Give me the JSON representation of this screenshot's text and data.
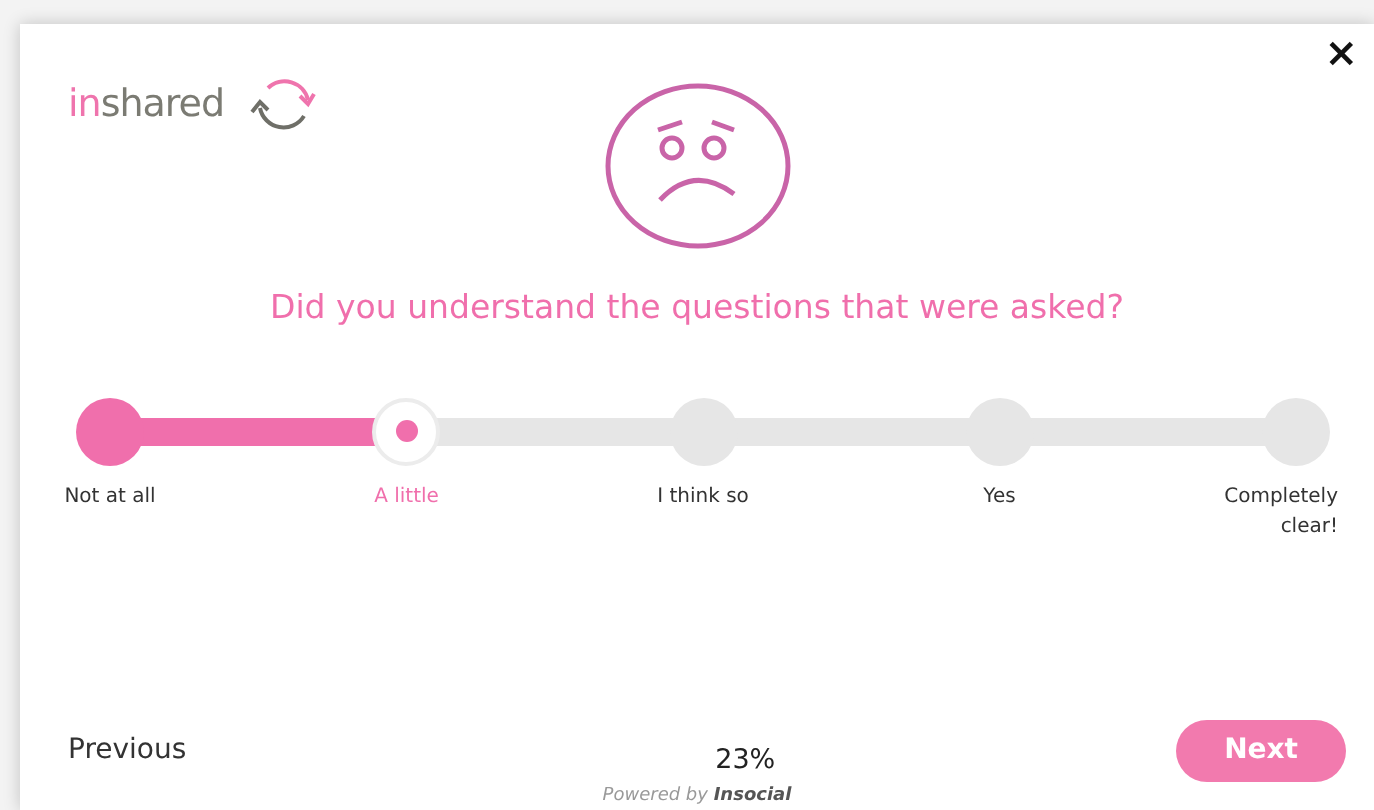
{
  "logo": {
    "prefix": "in",
    "suffix": "shared"
  },
  "close": "×",
  "question": "Did you understand the questions that were asked?",
  "options": [
    {
      "label": "Not at all",
      "selected": false
    },
    {
      "label": "A little",
      "selected": true
    },
    {
      "label": "I think so",
      "selected": false
    },
    {
      "label": "Yes",
      "selected": false
    },
    {
      "label": "Completely clear!",
      "selected": false
    }
  ],
  "footer": {
    "previous": "Previous",
    "progress": "23%",
    "next": "Next",
    "powered_by": "Powered by **Insocial**"
  }
}
